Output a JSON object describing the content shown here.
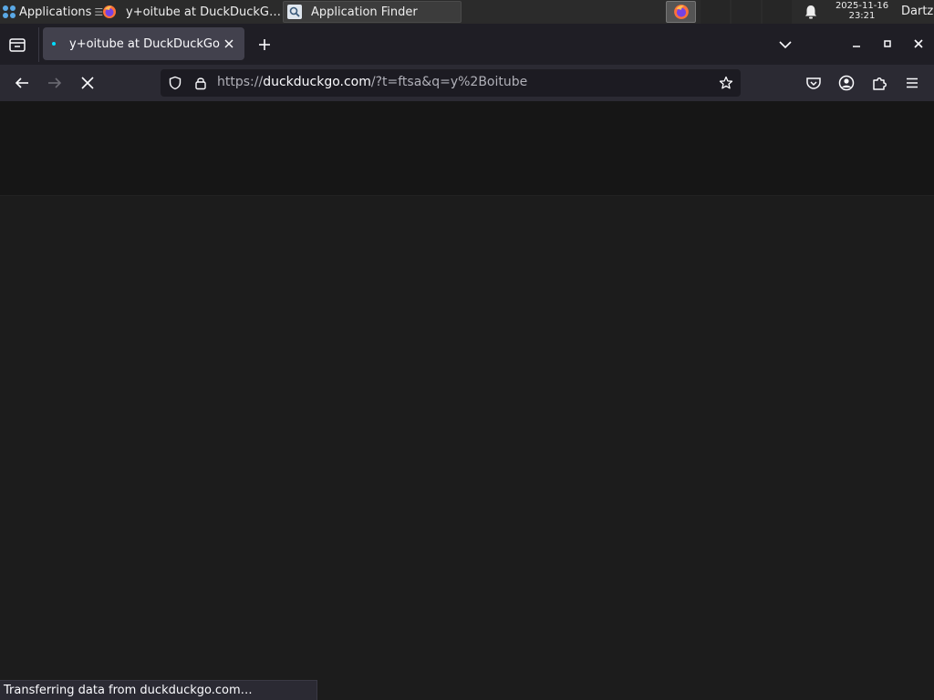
{
  "panel": {
    "applications_label": "Applications",
    "separator_glyph": "☰",
    "tasks": [
      {
        "label": "y+oitube at DuckDuckG…",
        "icon": "firefox-icon"
      },
      {
        "label": "Application Finder",
        "icon": "search-icon"
      }
    ],
    "clock": {
      "date": "2025-11-16",
      "time": "23:21"
    },
    "user": "Dartz"
  },
  "browser": {
    "tab": {
      "title": "y+oitube at DuckDuckGo"
    },
    "url": {
      "scheme": "https://",
      "host": "duckduckgo.com",
      "path": "/?t=ftsa&q=y%2Boitube"
    }
  },
  "status": {
    "text": "Transferring data from duckduckgo.com…"
  },
  "colors": {
    "panel_bg": "#2b2b2b",
    "tabstrip_bg": "#1f1e25",
    "toolbar_bg": "#2b2a33",
    "content_bg": "#1c1c1c",
    "accent": "#00ddff"
  }
}
